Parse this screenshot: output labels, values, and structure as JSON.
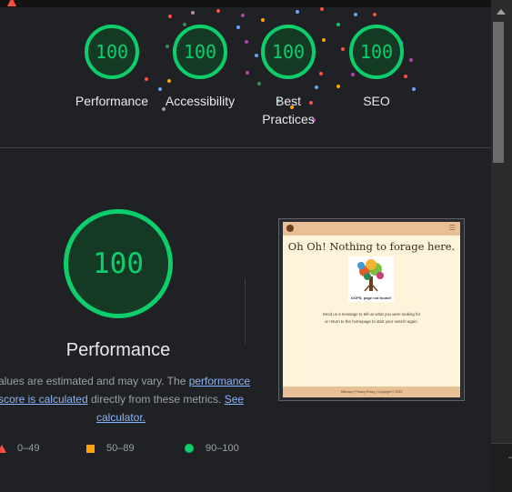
{
  "gauges": [
    {
      "label": "Performance",
      "score": "100"
    },
    {
      "label": "Accessibility",
      "score": "100"
    },
    {
      "label": "Best Practices",
      "score": "100"
    },
    {
      "label": "SEO",
      "score": "100"
    }
  ],
  "performance": {
    "score": "100",
    "title": "Performance",
    "desc_prefix": "Values are estimated and may vary. The ",
    "desc_link": "performance score is calculated",
    "desc_middle": " directly from these metrics. ",
    "desc_calc_link": "See calculator."
  },
  "legend": [
    {
      "shape": "triangle",
      "color": "#ff4e42",
      "label": "0–49"
    },
    {
      "shape": "square",
      "color": "#ffa400",
      "label": "50–89"
    },
    {
      "shape": "circle",
      "color": "#0cce6b",
      "label": "90–100"
    }
  ],
  "screenshot": {
    "headline": "Oh Oh! Nothing to forage here.",
    "card_caption": "OOPS, page not found!",
    "body_line1": "Send us a message to tell us what you were looking for",
    "body_line2": "or return to the homepage to start your search again.",
    "footer": "Sitemap | Privacy Policy | Copyright © 2023",
    "menu_icon": "hamburger-icon"
  },
  "colors": {
    "pass": "#0cce6b",
    "average": "#ffa400",
    "fail": "#ff4e42",
    "link": "#8ab4f8",
    "background": "#202124"
  }
}
